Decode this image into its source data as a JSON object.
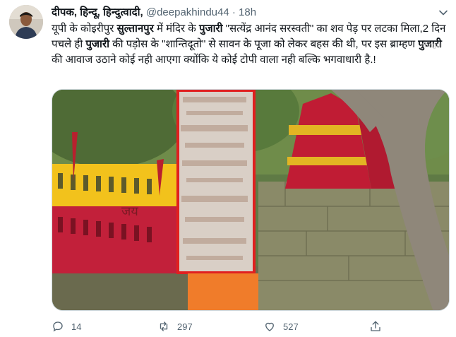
{
  "tweet": {
    "display_name": "दीपक, हिन्दू, हिन्दुत्वादी,",
    "handle": "@deepakhindu44",
    "separator": "·",
    "time": "18h",
    "text_parts": [
      {
        "text": "यूपी के कोइरीपुर ",
        "bold": false
      },
      {
        "text": "सुल्तानपुर",
        "bold": true
      },
      {
        "text": " में मंदिर के ",
        "bold": false
      },
      {
        "text": "पुजारी",
        "bold": true
      },
      {
        "text": " \"सत्येंद्र आनंद सरस्वती\" का शव पेड़ पर लटका मिला,2 दिन पचले ही ",
        "bold": false
      },
      {
        "text": "पुजारी",
        "bold": true
      },
      {
        "text": " की पड़ोस के \"शान्तिदूतो\" से सावन के पूजा को लेकर बहस की थी, पर इस ब्राम्हण ",
        "bold": false
      },
      {
        "text": "पुजारी",
        "bold": true
      },
      {
        "text": " की आवाज उठाने कोई नही आएगा क्योंकि ये कोई टोपी वाला नही बल्कि भगवाधारी है.!",
        "bold": false
      }
    ],
    "watermark": "anagul",
    "photo_wall_text": "जय"
  },
  "actions": {
    "reply_count": "14",
    "retweet_count": "297",
    "like_count": "527"
  },
  "icons": {
    "avatar": "user-avatar",
    "caret": "chevron-down-icon",
    "reply": "reply-icon",
    "retweet": "retweet-icon",
    "like": "heart-icon",
    "share": "share-icon"
  },
  "colors": {
    "text": "#0f1419",
    "secondary": "#536471",
    "redaction_border": "#e02020",
    "wall_yellow": "#f2c21c",
    "wall_red": "#c2203a"
  }
}
